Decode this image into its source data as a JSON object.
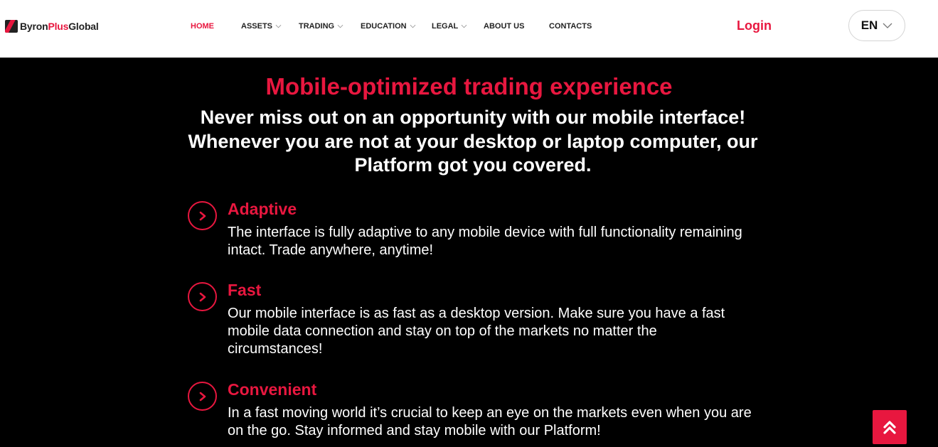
{
  "header": {
    "logo": {
      "part1": "Byron",
      "part2": "Plus",
      "part3": "Global"
    },
    "nav": [
      {
        "label": "HOME",
        "active": true,
        "dropdown": false
      },
      {
        "label": "ASSETS",
        "active": false,
        "dropdown": true
      },
      {
        "label": "TRADING",
        "active": false,
        "dropdown": true
      },
      {
        "label": "EDUCATION",
        "active": false,
        "dropdown": true
      },
      {
        "label": "LEGAL",
        "active": false,
        "dropdown": true
      },
      {
        "label": "ABOUT US",
        "active": false,
        "dropdown": false
      },
      {
        "label": "CONTACTS",
        "active": false,
        "dropdown": false
      }
    ],
    "login_label": "Login",
    "language": "EN"
  },
  "main": {
    "headline": "Mobile-optimized trading experience",
    "subhead": "Never miss out on an opportunity with our mobile interface! Whenever you are not at your desktop or laptop computer, our Platform got you covered.",
    "features": [
      {
        "title": "Adaptive",
        "description": "The interface is fully adaptive to any mobile device with full functionality remaining intact. Trade anywhere, anytime!",
        "icon": "chevron-right-circle-icon"
      },
      {
        "title": "Fast",
        "description": "Our mobile interface is as fast as a desktop version. Make sure you have a fast mobile data connection and stay on top of the markets no matter the circumstances!",
        "icon": "chevron-right-circle-icon"
      },
      {
        "title": "Convenient",
        "description": "In a fast moving world it’s crucial to keep an eye on the markets even when you are on the go. Stay informed and stay mobile with our Platform!",
        "icon": "chevron-right-circle-icon"
      }
    ]
  },
  "scroll_top_icon": "double-chevron-up-icon",
  "colors": {
    "accent": "#e8173f",
    "background": "#000000",
    "header_bg": "#ffffff",
    "text_light": "#ffffff"
  }
}
